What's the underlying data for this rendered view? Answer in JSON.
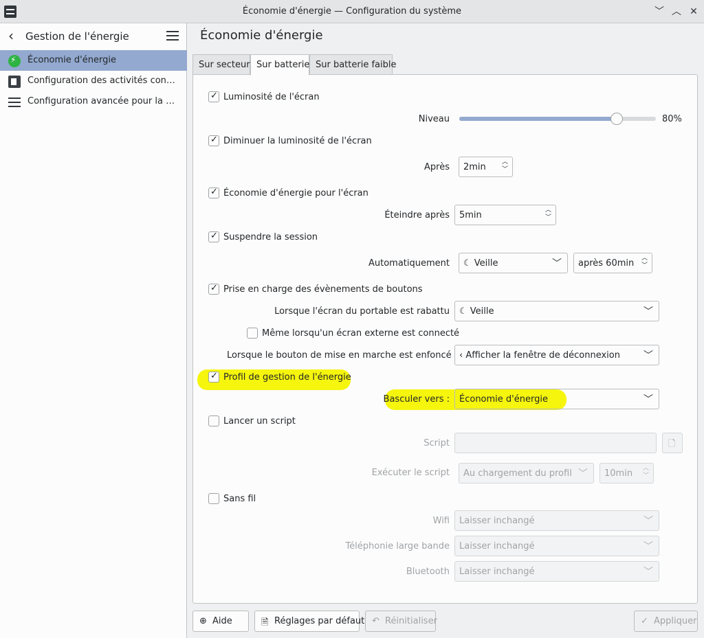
{
  "window": {
    "title": "Économie d'énergie — Configuration du système"
  },
  "sidebar": {
    "title": "Gestion de l'énergie",
    "items": [
      {
        "label": "Économie d'énergie",
        "icon": "power-save-icon",
        "active": true
      },
      {
        "label": "Configuration des activités con…",
        "icon": "activities-icon"
      },
      {
        "label": "Configuration avancée pour la …",
        "icon": "advanced-menu-icon"
      }
    ]
  },
  "main": {
    "title": "Économie d'énergie",
    "tabs": [
      {
        "label": "Sur secteur"
      },
      {
        "label": "Sur batterie",
        "active": true
      },
      {
        "label": "Sur batterie faible"
      }
    ]
  },
  "settings": {
    "brightness": {
      "label": "Luminosité de l'écran",
      "checked": true,
      "level_label": "Niveau",
      "level_value": "80%",
      "level_fraction": 0.8
    },
    "dim": {
      "label": "Diminuer la luminosité de l'écran",
      "checked": true,
      "after_label": "Après",
      "after_value": "2min"
    },
    "screen_save": {
      "label": "Économie d'énergie pour l'écran",
      "checked": true,
      "off_label": "Éteindre après",
      "off_value": "5min"
    },
    "suspend": {
      "label": "Suspendre la session",
      "checked": true,
      "auto_label": "Automatiquement",
      "action_value": "Veille",
      "delay_value": "après 60min"
    },
    "buttons": {
      "label": "Prise en charge des évènements de boutons",
      "checked": true,
      "lid_label": "Lorsque l'écran du portable est rabattu",
      "lid_value": "Veille",
      "external_label": "Même lorsqu'un écran externe est connecté",
      "external_checked": false,
      "power_label": "Lorsque le bouton de mise en marche est enfoncé",
      "power_value": "Afficher la fenêtre de déconnexion"
    },
    "profile": {
      "label": "Profil de gestion de l'énergie",
      "checked": true,
      "switch_label": "Basculer vers :",
      "switch_value": "Économie d'énergie"
    },
    "script": {
      "label": "Lancer un script",
      "checked": false,
      "script_label": "Script",
      "script_value": "",
      "exec_label": "Exécuter le script",
      "exec_value": "Au chargement du profil",
      "delay_value": "10min"
    },
    "wireless": {
      "label": "Sans fil",
      "checked": false,
      "wifi_label": "Wifi",
      "wifi_value": "Laisser inchangé",
      "mobile_label": "Téléphonie large bande",
      "mobile_value": "Laisser inchangé",
      "bt_label": "Bluetooth",
      "bt_value": "Laisser inchangé"
    }
  },
  "footer": {
    "help": "Aide",
    "defaults": "Réglages par défaut",
    "reset": "Réinitialiser",
    "apply": "Appliquer"
  },
  "colors": {
    "highlight": "#f4f400",
    "accent": "#93a9cf",
    "power_icon": "#2fb344"
  }
}
